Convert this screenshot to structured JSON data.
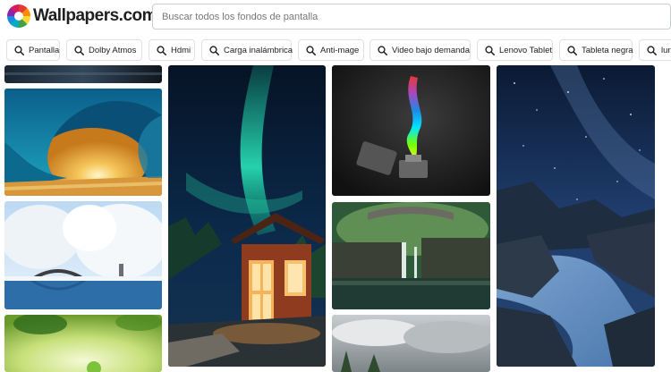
{
  "header": {
    "logo_text": "Wallpapers.com",
    "search_placeholder": "Buscar todos los fondos de pantalla"
  },
  "tags": [
    {
      "label": "Pantalla",
      "icon": "search-icon"
    },
    {
      "label": "Dolby Atmos",
      "icon": "search-icon"
    },
    {
      "label": "Hdmi",
      "icon": "search-icon"
    },
    {
      "label": "Carga inalámbrica",
      "icon": "search-icon"
    },
    {
      "label": "Anti-mage",
      "icon": "search-icon"
    },
    {
      "label": "Video bajo demanda",
      "icon": "search-icon"
    },
    {
      "label": "Lenovo Tablet",
      "icon": "search-icon"
    },
    {
      "label": "Tableta negra",
      "icon": "search-icon"
    },
    {
      "label": "lun",
      "icon": "search-icon"
    }
  ],
  "wallpapers": [
    {
      "name": "dark-strip-wallpaper",
      "subject": "dark water"
    },
    {
      "name": "ocean-wave-sunset-wallpaper",
      "subject": "ocean wave at sunset"
    },
    {
      "name": "snowy-bridge-wallpaper",
      "subject": "snowy trees and bridge"
    },
    {
      "name": "green-blur-wallpaper",
      "subject": "green bokeh"
    },
    {
      "name": "aurora-cabin-wallpaper",
      "subject": "aurora over lit cabin"
    },
    {
      "name": "rainbow-lighter-wallpaper",
      "subject": "lighter with rainbow flame"
    },
    {
      "name": "waterfall-bridge-wallpaper",
      "subject": "waterfall under stone bridge"
    },
    {
      "name": "cloudy-sky-wallpaper",
      "subject": "cloudy sky over trees"
    },
    {
      "name": "starry-river-wallpaper",
      "subject": "starry night over rocky river"
    }
  ]
}
